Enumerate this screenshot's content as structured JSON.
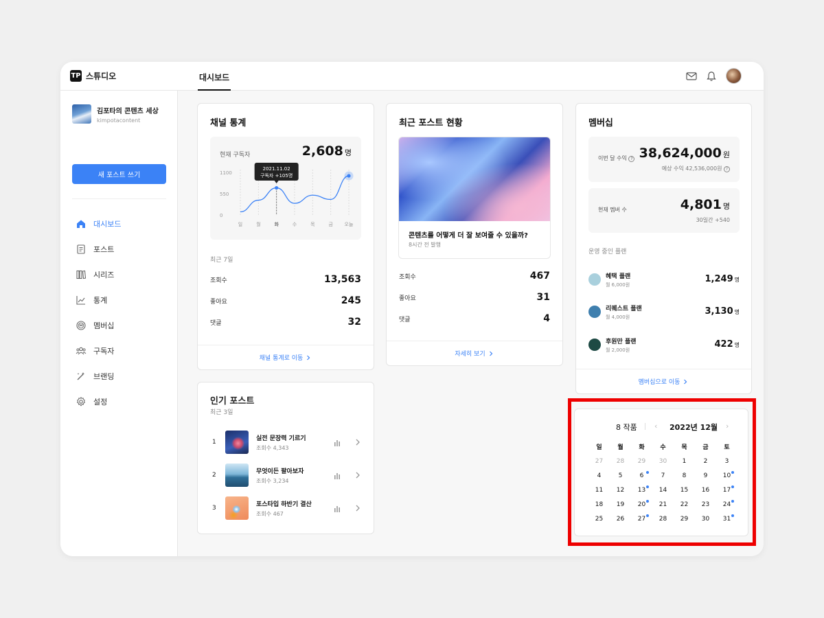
{
  "app": {
    "name": "스튜디오",
    "logo_mark": "TP"
  },
  "header": {
    "tab": "대시보드",
    "icons": [
      "mail-icon",
      "bell-icon"
    ]
  },
  "sidebar": {
    "profile": {
      "name": "김포타의 콘텐츠 세상",
      "id": "kimpotacontent"
    },
    "new_post": "새 포스트 쓰기",
    "items": [
      {
        "label": "대시보드",
        "icon": "home-icon",
        "active": true
      },
      {
        "label": "포스트",
        "icon": "posts-icon"
      },
      {
        "label": "시리즈",
        "icon": "series-icon"
      },
      {
        "label": "통계",
        "icon": "stats-icon"
      },
      {
        "label": "멤버십",
        "icon": "membership-icon"
      },
      {
        "label": "구독자",
        "icon": "subscribers-icon"
      },
      {
        "label": "브랜딩",
        "icon": "branding-icon"
      },
      {
        "label": "설정",
        "icon": "settings-icon"
      }
    ]
  },
  "channel": {
    "title": "채널 통계",
    "current_label": "현재 구독자",
    "current_value": "2,608",
    "unit": "명",
    "tooltip_date": "2021.11.02",
    "tooltip_text": "구독자 +105명",
    "recent_label": "최근 7일",
    "rows": [
      {
        "label": "조회수",
        "value": "13,563"
      },
      {
        "label": "좋아요",
        "value": "245"
      },
      {
        "label": "댓글",
        "value": "32"
      }
    ],
    "footer": "채널 통계로 이동"
  },
  "chart_data": {
    "type": "line",
    "categories": [
      "일",
      "월",
      "화",
      "수",
      "목",
      "금",
      "오늘"
    ],
    "y_ticks": [
      "1100",
      "550",
      "0"
    ],
    "ylim": [
      0,
      1100
    ],
    "values": [
      80,
      380,
      700,
      300,
      510,
      400,
      1010
    ],
    "highlight_index": 2
  },
  "recent_post": {
    "title": "최근 포스트 현황",
    "post_title": "콘텐츠를 어떻게 더 잘 보여줄 수 있을까?",
    "post_meta": "8시간 전 발행",
    "rows": [
      {
        "label": "조회수",
        "value": "467"
      },
      {
        "label": "좋아요",
        "value": "31"
      },
      {
        "label": "댓글",
        "value": "4"
      }
    ],
    "footer": "자세히 보기"
  },
  "membership": {
    "title": "멤버십",
    "revenue_label": "이번 달 수익",
    "revenue_value": "38,624,000",
    "revenue_unit": "원",
    "expected": "예상 수익 42,536,000원",
    "members_label": "현재 멤버 수",
    "members_value": "4,801",
    "members_unit": "명",
    "members_sub": "30일간 +540",
    "plans_label": "운영 중인 플랜",
    "plans": [
      {
        "name": "혜택 플랜",
        "price": "월 6,000원",
        "count": "1,249",
        "unit": "명",
        "color": "#a9d0dd"
      },
      {
        "name": "리퀘스트 플랜",
        "price": "월 4,000원",
        "count": "3,130",
        "unit": "명",
        "color": "#3f7fae"
      },
      {
        "name": "후원만 플랜",
        "price": "월 2,000원",
        "count": "422",
        "unit": "명",
        "color": "#1e4a44"
      }
    ],
    "footer": "멤버십으로 이동"
  },
  "popular": {
    "title": "인기 포스트",
    "sub": "최근 3일",
    "items": [
      {
        "rank": "1",
        "title": "실전 문장력 기르기",
        "meta": "조회수 4,343"
      },
      {
        "rank": "2",
        "title": "무엇이든 팔아보자",
        "meta": "조회수 3,234"
      },
      {
        "rank": "3",
        "title": "포스타입 하반기 결산",
        "meta": "조회수 467"
      }
    ]
  },
  "calendar": {
    "count": "8 작품",
    "month": "2022년 12월",
    "weekdays": [
      "일",
      "월",
      "화",
      "수",
      "목",
      "금",
      "토"
    ],
    "weeks": [
      [
        "27",
        "28",
        "29",
        "30",
        "1",
        "2",
        "3"
      ],
      [
        "4",
        "5",
        "6",
        "7",
        "8",
        "9",
        "10"
      ],
      [
        "11",
        "12",
        "13",
        "14",
        "15",
        "16",
        "17"
      ],
      [
        "18",
        "19",
        "20",
        "21",
        "22",
        "23",
        "24"
      ],
      [
        "25",
        "26",
        "27",
        "28",
        "29",
        "30",
        "31"
      ]
    ],
    "muted_days": [
      "27",
      "28",
      "29",
      "30"
    ],
    "dotted_days": [
      "6",
      "10",
      "13",
      "17",
      "20",
      "24",
      "27",
      "31"
    ]
  }
}
